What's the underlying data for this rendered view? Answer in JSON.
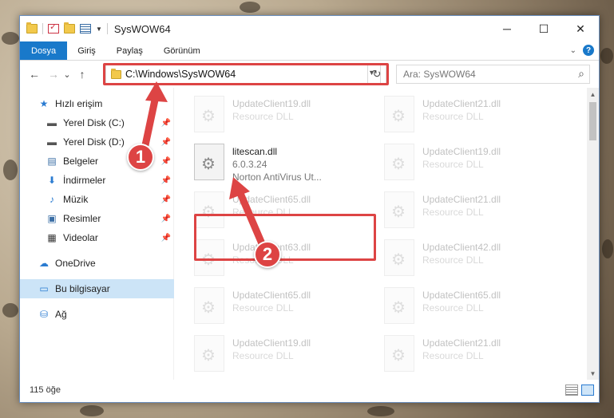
{
  "window": {
    "title": "SysWOW64",
    "controls": {
      "minimize": "─",
      "maximize": "☐",
      "close": "✕"
    }
  },
  "ribbon": {
    "tabs": [
      "Dosya",
      "Giriş",
      "Paylaş",
      "Görünüm"
    ],
    "active_tab": "Dosya",
    "help": "?"
  },
  "navigation": {
    "back": "←",
    "forward": "→",
    "recent": "⌄",
    "up": "↑",
    "address": "C:\\Windows\\SysWOW64",
    "refresh": "↻",
    "search_placeholder": "Ara: SysWOW64"
  },
  "sidebar": {
    "items": [
      {
        "label": "Hızlı erişim",
        "icon": "star-icon",
        "glyph": "★",
        "color": "#2a7bd1",
        "pinned": false
      },
      {
        "label": "Yerel Disk (C:)",
        "icon": "drive-icon",
        "glyph": "▬",
        "color": "#555",
        "pinned": true
      },
      {
        "label": "Yerel Disk (D:)",
        "icon": "drive-icon",
        "glyph": "▬",
        "color": "#555",
        "pinned": true
      },
      {
        "label": "Belgeler",
        "icon": "documents-icon",
        "glyph": "▤",
        "color": "#3a6ea5",
        "pinned": true
      },
      {
        "label": "İndirmeler",
        "icon": "download-icon",
        "glyph": "⬇",
        "color": "#2a7bd1",
        "pinned": true
      },
      {
        "label": "Müzik",
        "icon": "music-icon",
        "glyph": "♪",
        "color": "#2a7bd1",
        "pinned": true
      },
      {
        "label": "Resimler",
        "icon": "pictures-icon",
        "glyph": "▣",
        "color": "#3a6ea5",
        "pinned": true
      },
      {
        "label": "Videolar",
        "icon": "video-icon",
        "glyph": "▦",
        "color": "#333",
        "pinned": true
      },
      {
        "label": "OneDrive",
        "icon": "cloud-icon",
        "glyph": "☁",
        "color": "#2a7bd1",
        "pinned": false
      },
      {
        "label": "Bu bilgisayar",
        "icon": "computer-icon",
        "glyph": "▭",
        "color": "#2a7bd1",
        "pinned": false
      },
      {
        "label": "Ağ",
        "icon": "network-icon",
        "glyph": "⛁",
        "color": "#2a7bd1",
        "pinned": false
      }
    ],
    "selected": "Bu bilgisayar"
  },
  "files": {
    "highlighted": {
      "name": "litescan.dll",
      "version": "6.0.3.24",
      "description": "Norton AntiVirus Ut..."
    },
    "left_column": [
      {
        "name": "UpdateClient19.dll",
        "type": "Resource DLL"
      },
      {
        "name": "UpdateClient65.dll",
        "type": "Resource DLL"
      },
      {
        "name": "UpdateClient63.dll",
        "type": "Resource DLL"
      },
      {
        "name": "UpdateClient65.dll",
        "type": "Resource DLL"
      },
      {
        "name": "UpdateClient19.dll",
        "type": "Resource DLL"
      }
    ],
    "right_column": [
      {
        "name": "UpdateClient21.dll",
        "type": "Resource DLL"
      },
      {
        "name": "UpdateClient19.dll",
        "type": "Resource DLL"
      },
      {
        "name": "UpdateClient21.dll",
        "type": "Resource DLL"
      },
      {
        "name": "UpdateClient42.dll",
        "type": "Resource DLL"
      },
      {
        "name": "UpdateClient65.dll",
        "type": "Resource DLL"
      },
      {
        "name": "UpdateClient21.dll",
        "type": "Resource DLL"
      }
    ]
  },
  "status": {
    "item_count": "115 öğe"
  },
  "annotations": {
    "step1": "1",
    "step2": "2",
    "color": "#dd4444"
  }
}
